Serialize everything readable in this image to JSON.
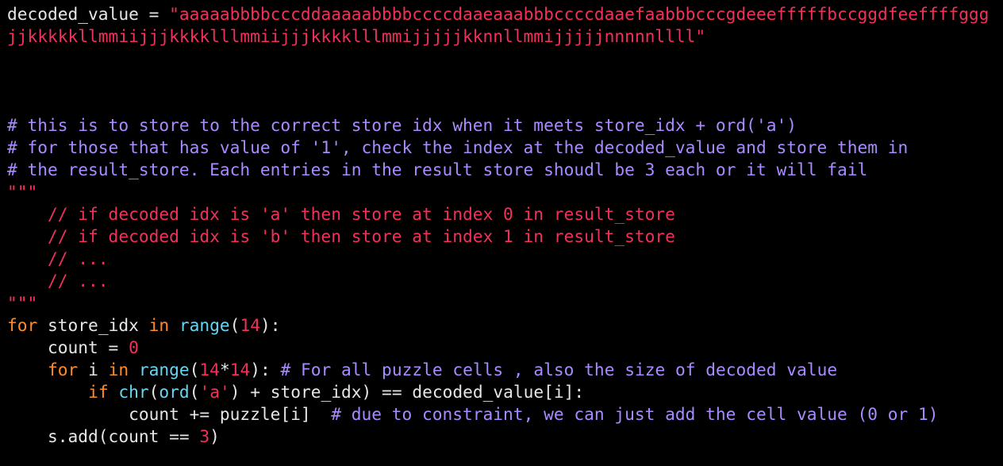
{
  "editor": {
    "colors": {
      "background": "#000000",
      "default": "#e6e6e6",
      "string": "#f0325a",
      "comment": "#a98bff",
      "keyword": "#ff8a2a",
      "builtin": "#67d6f5",
      "number": "#f0325a"
    },
    "lines": [
      [
        {
          "t": "decoded_value = ",
          "k": "default"
        },
        {
          "t": "\"aaaaabbbbcccddaaaaabbbbccccdaaeaaabbbccccdaaefaabbbcccgdeeefffffbccggdfeeffffggg",
          "k": "string"
        }
      ],
      [
        {
          "t": "jjkkkkkllmmiijjjkkkklllmmiijjjkkkklllmmijjjjjkknnllmmijjjjjnnnnnllll\"",
          "k": "string"
        }
      ],
      [],
      [],
      [],
      [
        {
          "t": "# this is to store to the correct store idx when it meets store_idx + ord('a')",
          "k": "comment"
        }
      ],
      [
        {
          "t": "# for those that has value of '1', check the index at the decoded_value and store them in",
          "k": "comment"
        }
      ],
      [
        {
          "t": "# the result_store. Each entries in the result store shoudl be 3 each or it will fail",
          "k": "comment"
        }
      ],
      [
        {
          "t": "\"\"\"",
          "k": "string"
        }
      ],
      [
        {
          "t": "    // if decoded idx is 'a' then store at index 0 in result_store",
          "k": "string"
        }
      ],
      [
        {
          "t": "    // if decoded idx is 'b' then store at index 1 in result_store",
          "k": "string"
        }
      ],
      [
        {
          "t": "    // ...",
          "k": "string"
        }
      ],
      [
        {
          "t": "    // ...",
          "k": "string"
        }
      ],
      [
        {
          "t": "\"\"\"",
          "k": "string"
        }
      ],
      [
        {
          "t": "for",
          "k": "keyword"
        },
        {
          "t": " store_idx ",
          "k": "default"
        },
        {
          "t": "in",
          "k": "keyword"
        },
        {
          "t": " ",
          "k": "default"
        },
        {
          "t": "range",
          "k": "builtin"
        },
        {
          "t": "(",
          "k": "default"
        },
        {
          "t": "14",
          "k": "number"
        },
        {
          "t": "):",
          "k": "default"
        }
      ],
      [
        {
          "t": "    count = ",
          "k": "default"
        },
        {
          "t": "0",
          "k": "number"
        }
      ],
      [
        {
          "t": "    ",
          "k": "default"
        },
        {
          "t": "for",
          "k": "keyword"
        },
        {
          "t": " i ",
          "k": "default"
        },
        {
          "t": "in",
          "k": "keyword"
        },
        {
          "t": " ",
          "k": "default"
        },
        {
          "t": "range",
          "k": "builtin"
        },
        {
          "t": "(",
          "k": "default"
        },
        {
          "t": "14",
          "k": "number"
        },
        {
          "t": "*",
          "k": "default"
        },
        {
          "t": "14",
          "k": "number"
        },
        {
          "t": "): ",
          "k": "default"
        },
        {
          "t": "# For all puzzle cells , also the size of decoded value",
          "k": "comment"
        }
      ],
      [
        {
          "t": "        ",
          "k": "default"
        },
        {
          "t": "if",
          "k": "keyword"
        },
        {
          "t": " ",
          "k": "default"
        },
        {
          "t": "chr",
          "k": "builtin"
        },
        {
          "t": "(",
          "k": "default"
        },
        {
          "t": "ord",
          "k": "builtin"
        },
        {
          "t": "(",
          "k": "default"
        },
        {
          "t": "'a'",
          "k": "string"
        },
        {
          "t": ") + store_idx) == decoded_value[i]:",
          "k": "default"
        }
      ],
      [
        {
          "t": "            count += puzzle[i]  ",
          "k": "default"
        },
        {
          "t": "# due to constraint, we can just add the cell value (0 or 1)",
          "k": "comment"
        }
      ],
      [
        {
          "t": "    s.add(count == ",
          "k": "default"
        },
        {
          "t": "3",
          "k": "number"
        },
        {
          "t": ")",
          "k": "default"
        }
      ]
    ]
  }
}
